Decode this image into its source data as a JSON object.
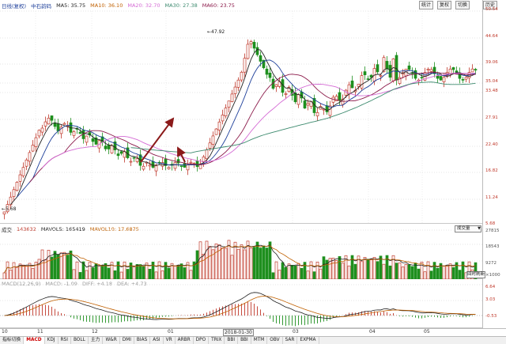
{
  "main": {
    "legend": {
      "code": "日线(复权)",
      "stock": "中石韵码",
      "ma5": "MA5: 35.75",
      "ma10": "MA10: 36.10",
      "ma20": "MA20: 32.70",
      "ma30": "MA30: 27.38",
      "ma60": "MA60: 23.75"
    },
    "toolbar": [
      "统计",
      "复权",
      "切换",
      "|",
      "历史"
    ],
    "yticks": [
      "50.54",
      "44.64",
      "39.06",
      "35.04",
      "33.48",
      "27.91",
      "22.40",
      "16.82",
      "11.24",
      "5.68"
    ],
    "high_label": "47.92",
    "low_label": "5.68",
    "colors": {
      "up": "#c0392b",
      "down": "#1e8f1e",
      "ma5": "#222222",
      "ma10": "#1d3f9a",
      "ma20": "#8b1a4a",
      "ma30": "#d46ad4",
      "ma60": "#3c8a6e"
    }
  },
  "volume": {
    "legend": {
      "label": "成交",
      "vol": "143632",
      "mavol5": "MAVOL5: 165419",
      "mavol10": "MAVOL10: 17.6875"
    },
    "dropdown": "成交量",
    "yticks": [
      "27815",
      "18543",
      "9272",
      "×1000"
    ],
    "button": "回时刷新"
  },
  "macd": {
    "legend": {
      "title": "MACD(12,26,9)",
      "macd": "MACD: -1.09",
      "diff": "DIFF: +4.18",
      "dea": "DEA: +4.73"
    },
    "yticks": [
      "6.64",
      "3.03",
      "-0.53"
    ]
  },
  "xaxis": {
    "labels": [
      "10",
      "11",
      "12",
      "01",
      "2018-01-30",
      "03",
      "04",
      "05"
    ]
  },
  "tabs": [
    "指标切换",
    "MACD",
    "KDJ",
    "RSI",
    "BOLL",
    "主力",
    "W&R",
    "DMI",
    "BIAS",
    "ASI",
    "VR",
    "ARBR",
    "DPO",
    "TRIX",
    "BBI",
    "BBI",
    "MTM",
    "OBV",
    "SAR",
    "EXPMA"
  ],
  "active_tab": "MACD"
}
